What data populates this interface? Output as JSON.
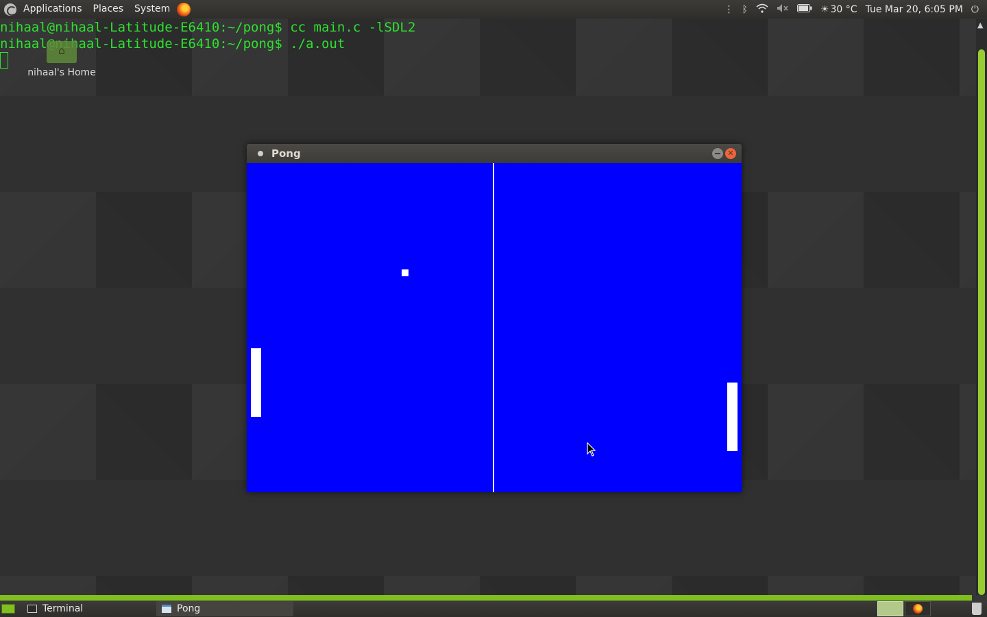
{
  "top_panel": {
    "menus": [
      "Applications",
      "Places",
      "System"
    ],
    "temperature": "30 °C",
    "datetime": "Tue Mar 20,  6:05 PM",
    "icons": [
      "menu-logo-icon",
      "firefox-icon",
      "bluetooth-icon",
      "wifi-icon",
      "volume-muted-icon",
      "battery-icon",
      "weather-icon",
      "power-icon"
    ]
  },
  "terminal": {
    "line1": "nihaal@nihaal-Latitude-E6410:~/pong$ cc main.c -lSDL2",
    "line2": "nihaal@nihaal-Latitude-E6410:~/pong$ ./a.out",
    "text_color": "#2ee02e"
  },
  "desktop": {
    "home_label": "nihaal's Home"
  },
  "pong_window": {
    "title": "Pong",
    "background_color": "#0000ff"
  },
  "taskbar": {
    "tasks": [
      "Terminal",
      "Pong"
    ],
    "accent": "#7fbf1f"
  }
}
